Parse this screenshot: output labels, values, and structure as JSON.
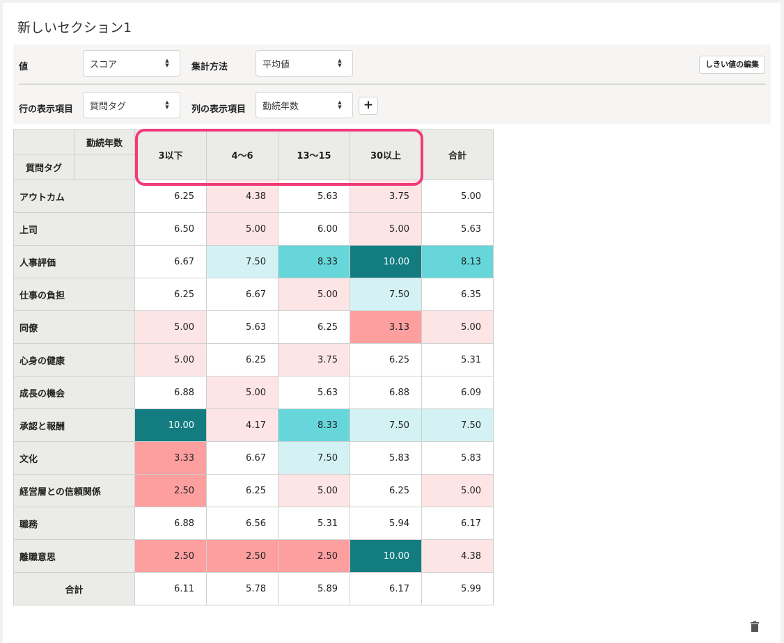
{
  "section": {
    "title": "新しいセクション1"
  },
  "controls": {
    "value_label": "値",
    "value_selected": "スコア",
    "agg_label": "集計方法",
    "agg_selected": "平均値",
    "row_label": "行の表示項目",
    "row_selected": "質問タグ",
    "col_label": "列の表示項目",
    "col_selected": "勤続年数",
    "add_label": "+",
    "edit_threshold_label": "しきい値の編集"
  },
  "table": {
    "col_dim_label": "勤続年数",
    "row_dim_label": "質問タグ",
    "columns": [
      "3以下",
      "4〜6",
      "13〜15",
      "30以上",
      "合計"
    ],
    "rows": [
      {
        "label": "アウトカム",
        "values": [
          "6.25",
          "4.38",
          "5.63",
          "3.75",
          "5.00"
        ]
      },
      {
        "label": "上司",
        "values": [
          "6.50",
          "5.00",
          "6.00",
          "5.00",
          "5.63"
        ]
      },
      {
        "label": "人事評価",
        "values": [
          "6.67",
          "7.50",
          "8.33",
          "10.00",
          "8.13"
        ]
      },
      {
        "label": "仕事の負担",
        "values": [
          "6.25",
          "6.67",
          "5.00",
          "7.50",
          "6.35"
        ]
      },
      {
        "label": "同僚",
        "values": [
          "5.00",
          "5.63",
          "6.25",
          "3.13",
          "5.00"
        ]
      },
      {
        "label": "心身の健康",
        "values": [
          "5.00",
          "6.25",
          "3.75",
          "6.25",
          "5.31"
        ]
      },
      {
        "label": "成長の機会",
        "values": [
          "6.88",
          "5.00",
          "5.63",
          "6.88",
          "6.09"
        ]
      },
      {
        "label": "承認と報酬",
        "values": [
          "10.00",
          "4.17",
          "8.33",
          "7.50",
          "7.50"
        ]
      },
      {
        "label": "文化",
        "values": [
          "3.33",
          "6.67",
          "7.50",
          "5.83",
          "5.83"
        ]
      },
      {
        "label": "経営層との信頼関係",
        "values": [
          "2.50",
          "6.25",
          "5.00",
          "6.25",
          "5.00"
        ]
      },
      {
        "label": "職務",
        "values": [
          "6.88",
          "6.56",
          "5.31",
          "5.94",
          "6.17"
        ]
      },
      {
        "label": "離職意思",
        "values": [
          "2.50",
          "2.50",
          "2.50",
          "10.00",
          "4.38"
        ]
      }
    ],
    "total_row": {
      "label": "合計",
      "values": [
        "6.11",
        "5.78",
        "5.89",
        "6.17",
        "5.99"
      ]
    }
  },
  "colors": {
    "white": "#ffffff",
    "light_pink": "#fde5e5",
    "salmon": "#fd9f9f",
    "light_cyan": "#d4f2f3",
    "cyan": "#66d6da",
    "teal": "#127c80",
    "highlight_border": "#f03a7a"
  },
  "cell_shades": [
    [
      "white",
      "light_pink",
      "white",
      "light_pink",
      "white"
    ],
    [
      "white",
      "light_pink",
      "white",
      "light_pink",
      "white"
    ],
    [
      "white",
      "light_cyan",
      "cyan",
      "teal",
      "cyan"
    ],
    [
      "white",
      "white",
      "light_pink",
      "light_cyan",
      "white"
    ],
    [
      "light_pink",
      "white",
      "white",
      "salmon",
      "light_pink"
    ],
    [
      "light_pink",
      "white",
      "light_pink",
      "white",
      "white"
    ],
    [
      "white",
      "light_pink",
      "white",
      "white",
      "white"
    ],
    [
      "teal",
      "light_pink",
      "cyan",
      "light_cyan",
      "light_cyan"
    ],
    [
      "salmon",
      "white",
      "light_cyan",
      "white",
      "white"
    ],
    [
      "salmon",
      "white",
      "light_pink",
      "white",
      "light_pink"
    ],
    [
      "white",
      "white",
      "white",
      "white",
      "white"
    ],
    [
      "salmon",
      "salmon",
      "salmon",
      "teal",
      "light_pink"
    ]
  ],
  "icons": {
    "trash": "trash-icon"
  }
}
